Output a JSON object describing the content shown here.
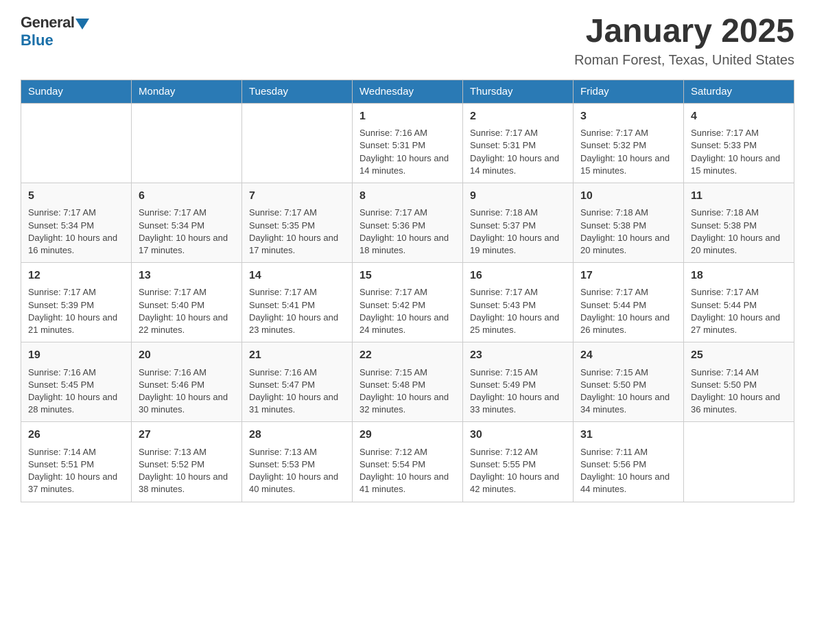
{
  "logo": {
    "general": "General",
    "blue": "Blue"
  },
  "header": {
    "title": "January 2025",
    "subtitle": "Roman Forest, Texas, United States"
  },
  "calendar": {
    "days_of_week": [
      "Sunday",
      "Monday",
      "Tuesday",
      "Wednesday",
      "Thursday",
      "Friday",
      "Saturday"
    ],
    "weeks": [
      [
        {
          "day": "",
          "info": ""
        },
        {
          "day": "",
          "info": ""
        },
        {
          "day": "",
          "info": ""
        },
        {
          "day": "1",
          "info": "Sunrise: 7:16 AM\nSunset: 5:31 PM\nDaylight: 10 hours and 14 minutes."
        },
        {
          "day": "2",
          "info": "Sunrise: 7:17 AM\nSunset: 5:31 PM\nDaylight: 10 hours and 14 minutes."
        },
        {
          "day": "3",
          "info": "Sunrise: 7:17 AM\nSunset: 5:32 PM\nDaylight: 10 hours and 15 minutes."
        },
        {
          "day": "4",
          "info": "Sunrise: 7:17 AM\nSunset: 5:33 PM\nDaylight: 10 hours and 15 minutes."
        }
      ],
      [
        {
          "day": "5",
          "info": "Sunrise: 7:17 AM\nSunset: 5:34 PM\nDaylight: 10 hours and 16 minutes."
        },
        {
          "day": "6",
          "info": "Sunrise: 7:17 AM\nSunset: 5:34 PM\nDaylight: 10 hours and 17 minutes."
        },
        {
          "day": "7",
          "info": "Sunrise: 7:17 AM\nSunset: 5:35 PM\nDaylight: 10 hours and 17 minutes."
        },
        {
          "day": "8",
          "info": "Sunrise: 7:17 AM\nSunset: 5:36 PM\nDaylight: 10 hours and 18 minutes."
        },
        {
          "day": "9",
          "info": "Sunrise: 7:18 AM\nSunset: 5:37 PM\nDaylight: 10 hours and 19 minutes."
        },
        {
          "day": "10",
          "info": "Sunrise: 7:18 AM\nSunset: 5:38 PM\nDaylight: 10 hours and 20 minutes."
        },
        {
          "day": "11",
          "info": "Sunrise: 7:18 AM\nSunset: 5:38 PM\nDaylight: 10 hours and 20 minutes."
        }
      ],
      [
        {
          "day": "12",
          "info": "Sunrise: 7:17 AM\nSunset: 5:39 PM\nDaylight: 10 hours and 21 minutes."
        },
        {
          "day": "13",
          "info": "Sunrise: 7:17 AM\nSunset: 5:40 PM\nDaylight: 10 hours and 22 minutes."
        },
        {
          "day": "14",
          "info": "Sunrise: 7:17 AM\nSunset: 5:41 PM\nDaylight: 10 hours and 23 minutes."
        },
        {
          "day": "15",
          "info": "Sunrise: 7:17 AM\nSunset: 5:42 PM\nDaylight: 10 hours and 24 minutes."
        },
        {
          "day": "16",
          "info": "Sunrise: 7:17 AM\nSunset: 5:43 PM\nDaylight: 10 hours and 25 minutes."
        },
        {
          "day": "17",
          "info": "Sunrise: 7:17 AM\nSunset: 5:44 PM\nDaylight: 10 hours and 26 minutes."
        },
        {
          "day": "18",
          "info": "Sunrise: 7:17 AM\nSunset: 5:44 PM\nDaylight: 10 hours and 27 minutes."
        }
      ],
      [
        {
          "day": "19",
          "info": "Sunrise: 7:16 AM\nSunset: 5:45 PM\nDaylight: 10 hours and 28 minutes."
        },
        {
          "day": "20",
          "info": "Sunrise: 7:16 AM\nSunset: 5:46 PM\nDaylight: 10 hours and 30 minutes."
        },
        {
          "day": "21",
          "info": "Sunrise: 7:16 AM\nSunset: 5:47 PM\nDaylight: 10 hours and 31 minutes."
        },
        {
          "day": "22",
          "info": "Sunrise: 7:15 AM\nSunset: 5:48 PM\nDaylight: 10 hours and 32 minutes."
        },
        {
          "day": "23",
          "info": "Sunrise: 7:15 AM\nSunset: 5:49 PM\nDaylight: 10 hours and 33 minutes."
        },
        {
          "day": "24",
          "info": "Sunrise: 7:15 AM\nSunset: 5:50 PM\nDaylight: 10 hours and 34 minutes."
        },
        {
          "day": "25",
          "info": "Sunrise: 7:14 AM\nSunset: 5:50 PM\nDaylight: 10 hours and 36 minutes."
        }
      ],
      [
        {
          "day": "26",
          "info": "Sunrise: 7:14 AM\nSunset: 5:51 PM\nDaylight: 10 hours and 37 minutes."
        },
        {
          "day": "27",
          "info": "Sunrise: 7:13 AM\nSunset: 5:52 PM\nDaylight: 10 hours and 38 minutes."
        },
        {
          "day": "28",
          "info": "Sunrise: 7:13 AM\nSunset: 5:53 PM\nDaylight: 10 hours and 40 minutes."
        },
        {
          "day": "29",
          "info": "Sunrise: 7:12 AM\nSunset: 5:54 PM\nDaylight: 10 hours and 41 minutes."
        },
        {
          "day": "30",
          "info": "Sunrise: 7:12 AM\nSunset: 5:55 PM\nDaylight: 10 hours and 42 minutes."
        },
        {
          "day": "31",
          "info": "Sunrise: 7:11 AM\nSunset: 5:56 PM\nDaylight: 10 hours and 44 minutes."
        },
        {
          "day": "",
          "info": ""
        }
      ]
    ]
  }
}
